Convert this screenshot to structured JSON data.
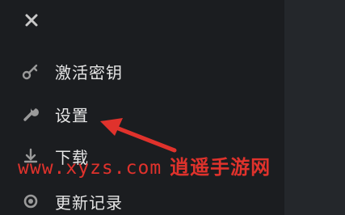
{
  "close": {
    "icon": "close-icon"
  },
  "menu": {
    "items": [
      {
        "label": "激活密钥",
        "icon": "key-icon"
      },
      {
        "label": "设置",
        "icon": "wrench-icon"
      },
      {
        "label": "下载",
        "icon": "download-icon"
      },
      {
        "label": "更新记录",
        "icon": "refresh-icon"
      }
    ]
  },
  "watermark": {
    "url": "www.xyzs.com",
    "site": "逍遥手游网",
    "color": "#e0322c"
  }
}
